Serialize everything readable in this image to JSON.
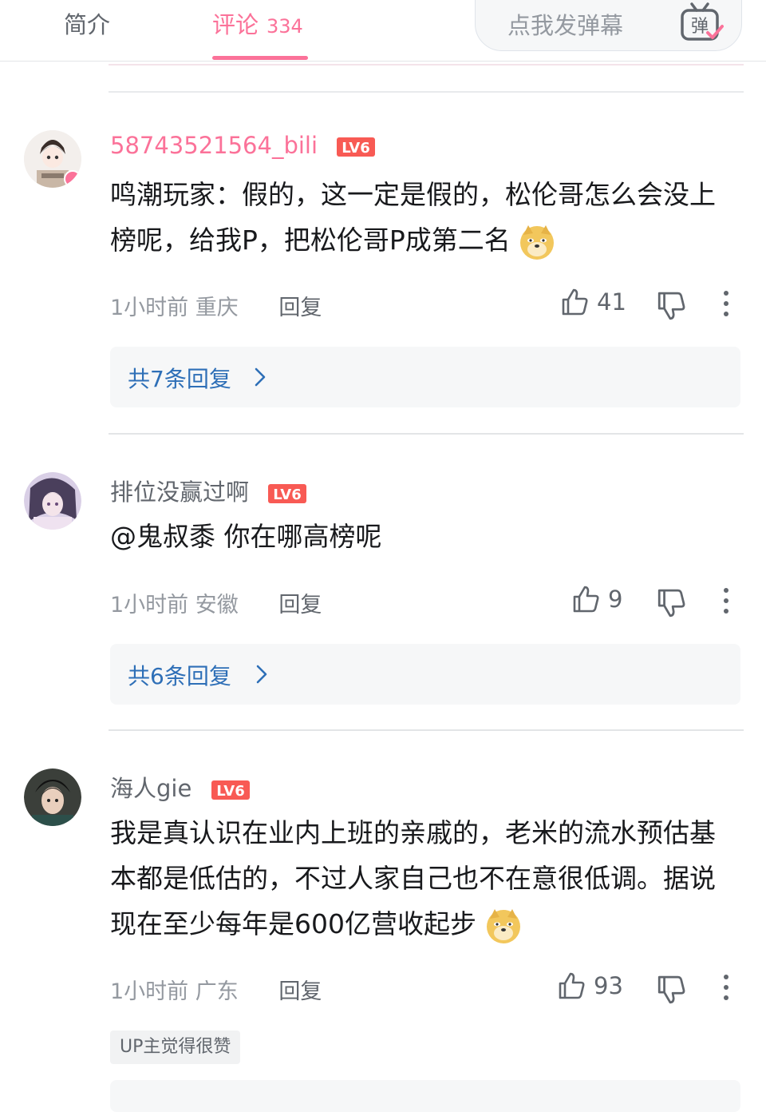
{
  "tabs": {
    "intro_label": "简介",
    "comments_label": "评论",
    "comments_count": "334"
  },
  "danmaku": {
    "placeholder": "点我发弹幕",
    "button_label": "弹"
  },
  "comments": [
    {
      "username": "58743521564_bili",
      "username_color": "#fb7299",
      "level": "LV6",
      "content": "鸣潮玩家：假的，这一定是假的，松伦哥怎么会没上榜呢，给我P，把松伦哥P成第二名",
      "time": "1小时前",
      "location": "重庆",
      "reply_label": "回复",
      "likes": "41",
      "replies_summary": "共7条回复"
    },
    {
      "username": "排位没赢过啊",
      "username_color": "#61666d",
      "level": "LV6",
      "content": "@鬼叔黍 你在哪高榜呢",
      "time": "1小时前",
      "location": "安徽",
      "reply_label": "回复",
      "likes": "9",
      "replies_summary": "共6条回复"
    },
    {
      "username": "海人gie",
      "username_color": "#61666d",
      "level": "LV6",
      "content": "我是真认识在业内上班的亲戚的，老米的流水预估基本都是低估的，不过人家自己也不在意很低调。据说现在至少每年是600亿营收起步",
      "time": "1小时前",
      "location": "广东",
      "reply_label": "回复",
      "likes": "93",
      "up_badge": "UP主觉得很赞"
    }
  ]
}
